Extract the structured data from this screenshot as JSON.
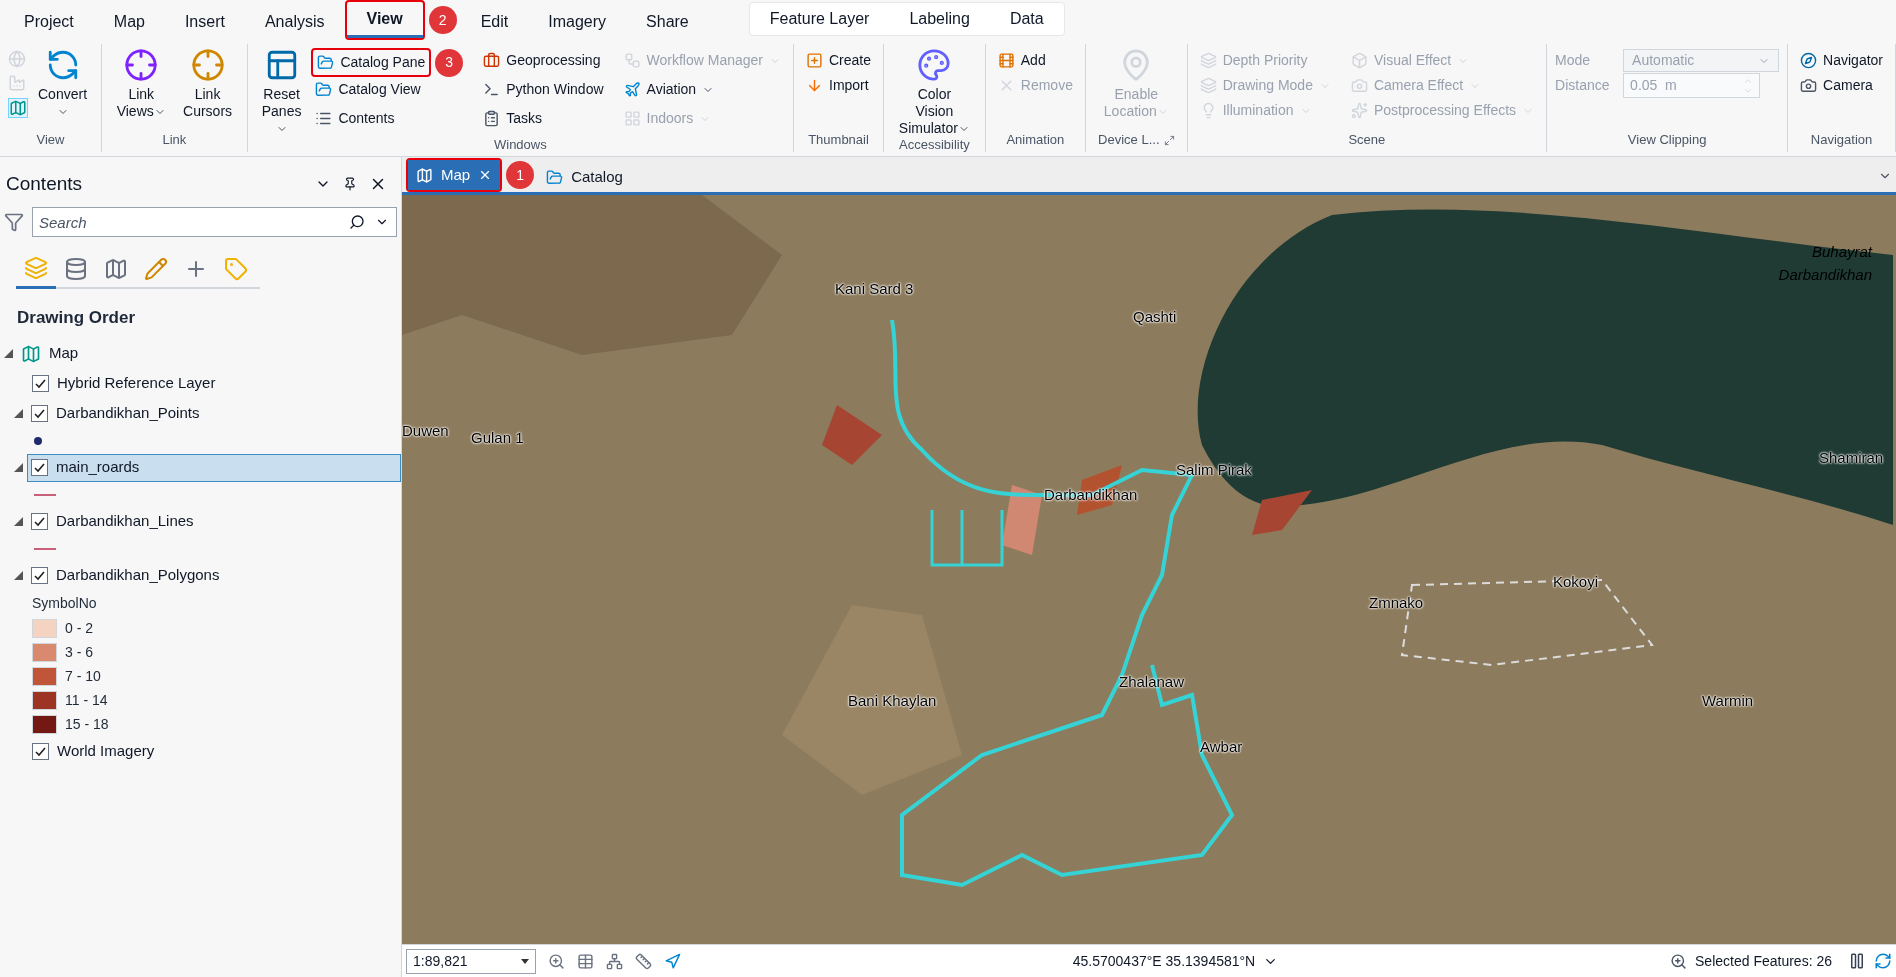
{
  "ribbon_tabs": [
    {
      "label": "Project",
      "selected": false
    },
    {
      "label": "Map",
      "selected": false
    },
    {
      "label": "Insert",
      "selected": false
    },
    {
      "label": "Analysis",
      "selected": false
    },
    {
      "label": "View",
      "selected": true,
      "callout": "2"
    },
    {
      "label": "Edit",
      "selected": false
    },
    {
      "label": "Imagery",
      "selected": false
    },
    {
      "label": "Share",
      "selected": false
    }
  ],
  "contextual_tabs": [
    {
      "label": "Feature Layer",
      "selected": false
    },
    {
      "label": "Labeling",
      "selected": false
    },
    {
      "label": "Data",
      "selected": false
    }
  ],
  "ribbon_groups": [
    {
      "label": "View",
      "items": [
        {
          "kind": "iconstack"
        },
        {
          "kind": "large",
          "label": "Convert",
          "dropdown": true,
          "disabled": false
        }
      ]
    },
    {
      "label": "Link",
      "items": [
        {
          "kind": "large",
          "label": "Link Views",
          "dropdown": true,
          "disabled": false
        },
        {
          "kind": "large",
          "label": "Link Cursors",
          "dropdown": false,
          "disabled": false
        }
      ]
    },
    {
      "label": "Windows",
      "items": [
        {
          "kind": "large",
          "label": "Reset Panes",
          "dropdown": true,
          "disabled": false
        },
        {
          "kind": "small",
          "label": "Catalog Pane",
          "dropdown": false,
          "disabled": false,
          "callout": "3"
        },
        {
          "kind": "small",
          "label": "Catalog View",
          "dropdown": false,
          "disabled": false
        },
        {
          "kind": "small",
          "label": "Contents",
          "dropdown": false,
          "disabled": false
        },
        {
          "kind": "small",
          "label": "Geoprocessing",
          "dropdown": false,
          "disabled": false
        },
        {
          "kind": "small",
          "label": "Python Window",
          "dropdown": false,
          "disabled": false
        },
        {
          "kind": "small",
          "label": "Tasks",
          "dropdown": false,
          "disabled": false
        },
        {
          "kind": "small",
          "label": "Workflow Manager",
          "dropdown": true,
          "disabled": true
        },
        {
          "kind": "small",
          "label": "Aviation",
          "dropdown": true,
          "disabled": false
        },
        {
          "kind": "small",
          "label": "Indoors",
          "dropdown": true,
          "disabled": true
        }
      ]
    },
    {
      "label": "Thumbnail",
      "items": [
        {
          "kind": "small",
          "label": "Create",
          "dropdown": false,
          "disabled": false
        },
        {
          "kind": "small",
          "label": "Import",
          "dropdown": false,
          "disabled": false
        }
      ]
    },
    {
      "label": "Accessibility",
      "items": [
        {
          "kind": "large",
          "label": "Color Vision Simulator",
          "dropdown": true,
          "disabled": false
        }
      ]
    },
    {
      "label": "Animation",
      "items": [
        {
          "kind": "small",
          "label": "Add",
          "dropdown": false,
          "disabled": false
        },
        {
          "kind": "small",
          "label": "Remove",
          "dropdown": false,
          "disabled": true
        }
      ]
    },
    {
      "label": "Device L...",
      "launcher": true,
      "items": [
        {
          "kind": "large",
          "label": "Enable Location",
          "dropdown": true,
          "disabled": true
        }
      ]
    },
    {
      "label": "Scene",
      "items": [
        {
          "kind": "small",
          "label": "Depth Priority",
          "dropdown": false,
          "disabled": true
        },
        {
          "kind": "small",
          "label": "Drawing Mode",
          "dropdown": true,
          "disabled": true
        },
        {
          "kind": "small",
          "label": "Illumination",
          "dropdown": true,
          "disabled": true
        },
        {
          "kind": "small",
          "label": "Visual Effect",
          "dropdown": true,
          "disabled": true
        },
        {
          "kind": "small",
          "label": "Camera Effect",
          "dropdown": true,
          "disabled": true
        },
        {
          "kind": "small",
          "label": "Postprocessing Effects",
          "dropdown": true,
          "disabled": true
        }
      ]
    },
    {
      "label": "View Clipping",
      "items": [
        {
          "kind": "dropdown-field",
          "label": "Mode",
          "value": "Automatic",
          "disabled": true
        },
        {
          "kind": "spinner-field",
          "label": "Distance",
          "value": "0.05  m",
          "disabled": true
        }
      ]
    },
    {
      "label": "Navigation",
      "items": [
        {
          "kind": "small",
          "label": "Navigator",
          "dropdown": false,
          "disabled": false
        },
        {
          "kind": "small",
          "label": "Camera",
          "dropdown": false,
          "disabled": false
        }
      ]
    }
  ],
  "contents": {
    "title": "Contents",
    "search": {
      "placeholder": "Search"
    },
    "view_tabs": [
      {
        "selected": true
      },
      {
        "selected": false
      },
      {
        "selected": false
      },
      {
        "selected": false
      },
      {
        "selected": false
      },
      {
        "selected": false
      }
    ],
    "heading": "Drawing Order",
    "map": {
      "label": "Map",
      "expanded": true
    },
    "layers": [
      {
        "label": "Hybrid Reference Layer",
        "checked": true,
        "selected": false
      },
      {
        "label": "Darbandikhan_Points",
        "checked": true,
        "selected": false,
        "expanded": true,
        "legend": {
          "kind": "point",
          "color": "#1f2a6b"
        }
      },
      {
        "label": "main_roards",
        "checked": true,
        "selected": true,
        "expanded": true,
        "legend": {
          "kind": "line",
          "color": "#c9607a"
        }
      },
      {
        "label": "Darbandikhan_Lines",
        "checked": true,
        "selected": false,
        "expanded": true,
        "legend": {
          "kind": "line",
          "color": "#c9607a"
        }
      },
      {
        "label": "Darbandikhan_Polygons",
        "checked": true,
        "selected": false,
        "expanded": true,
        "legend": {
          "kind": "ramp",
          "field": "SymbolNo",
          "classes": [
            {
              "label": "0 - 2",
              "color": "#f4d3c1"
            },
            {
              "label": "3 - 6",
              "color": "#d98a6e"
            },
            {
              "label": "7 - 10",
              "color": "#c15537"
            },
            {
              "label": "11 - 14",
              "color": "#9c3323"
            },
            {
              "label": "15 - 18",
              "color": "#731812"
            }
          ]
        }
      },
      {
        "label": "World Imagery",
        "checked": true,
        "selected": false
      }
    ]
  },
  "doc_tabs": [
    {
      "label": "Map",
      "selected": true,
      "callout": "1"
    },
    {
      "label": "Catalog",
      "selected": false
    }
  ],
  "map_labels": [
    "Kani Sard 3",
    "Qashti",
    "Duwen",
    "Gulan 1",
    "Salim Pirak",
    "Darbandikhan",
    "Buhayrat Darbandikhan",
    "Shamiran",
    "Kokoyi",
    "Zmnako",
    "Zhalanaw",
    "Bani Khaylan",
    "Warmin",
    "Awbar"
  ],
  "status_bar": {
    "scale": "1:89,821",
    "coordinates": "45.5700437°E 35.1394581°N",
    "selected_features": "Selected Features: 26"
  }
}
